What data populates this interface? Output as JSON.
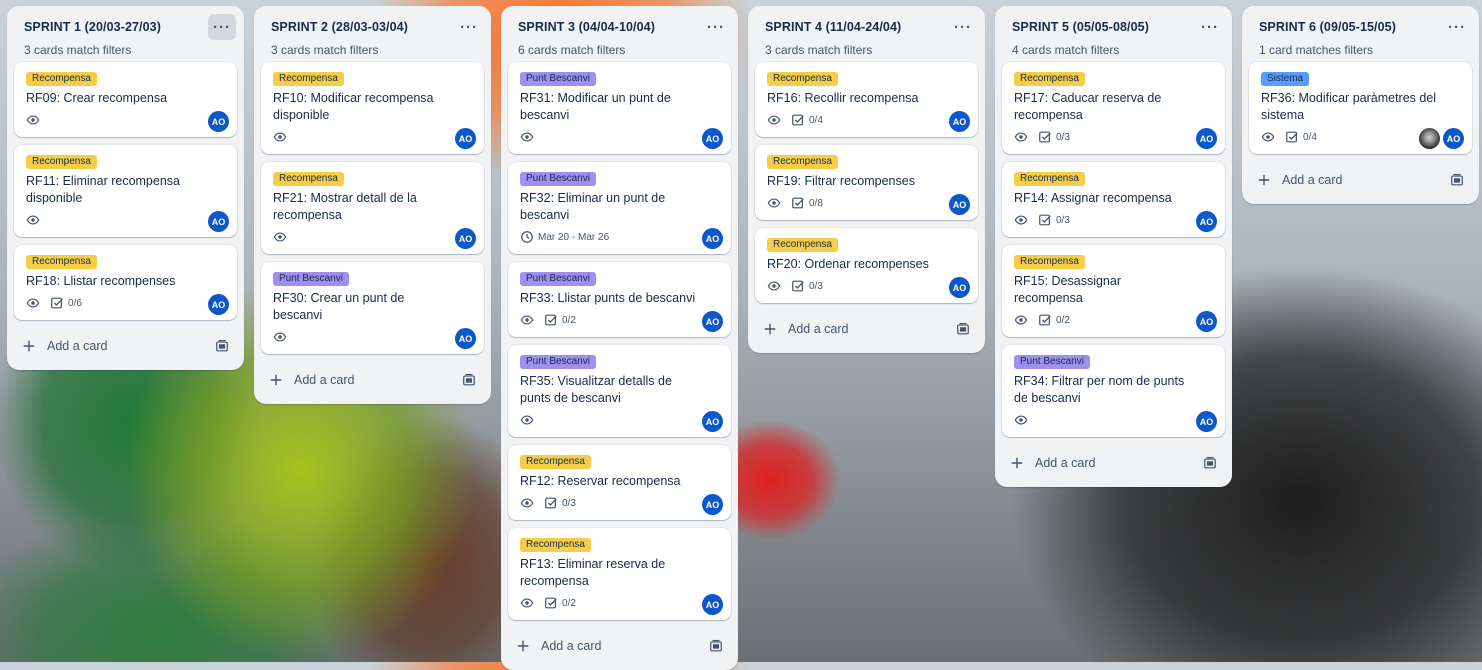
{
  "lists": [
    {
      "title": "SPRINT 1 (20/03-27/03)",
      "subtitle": "3 cards match filters",
      "menu_label": "···",
      "add_card_label": "Add a card",
      "cards": [
        {
          "label": "Recompensa",
          "label_color": "#f5cd47",
          "title": "RF09: Crear recompensa",
          "checklist": "",
          "dates": "",
          "members": [
            "AO"
          ]
        },
        {
          "label": "Recompensa",
          "label_color": "#f5cd47",
          "title": "RF11: Eliminar recompensa disponible",
          "checklist": "",
          "dates": "",
          "members": [
            "AO"
          ]
        },
        {
          "label": "Recompensa",
          "label_color": "#f5cd47",
          "title": "RF18: Llistar recompenses",
          "checklist": "0/6",
          "dates": "",
          "members": [
            "AO"
          ]
        }
      ]
    },
    {
      "title": "SPRINT 2 (28/03-03/04)",
      "subtitle": "3 cards match filters",
      "menu_label": "···",
      "add_card_label": "Add a card",
      "cards": [
        {
          "label": "Recompensa",
          "label_color": "#f5cd47",
          "title": "RF10: Modificar recompensa disponible",
          "checklist": "",
          "dates": "",
          "members": [
            "AO"
          ]
        },
        {
          "label": "Recompensa",
          "label_color": "#f5cd47",
          "title": "RF21: Mostrar detall de la recompensa",
          "checklist": "",
          "dates": "",
          "members": [
            "AO"
          ]
        },
        {
          "label": "Punt Bescanvi",
          "label_color": "#9f8fef",
          "title": "RF30: Crear un punt de bescanvi",
          "checklist": "",
          "dates": "",
          "members": [
            "AO"
          ]
        }
      ]
    },
    {
      "title": "SPRINT 3 (04/04-10/04)",
      "subtitle": "6 cards match filters",
      "menu_label": "···",
      "add_card_label": "Add a card",
      "cards": [
        {
          "label": "Punt Bescanvi",
          "label_color": "#9f8fef",
          "title": "RF31: Modificar un punt de bescanvi",
          "checklist": "",
          "dates": "",
          "members": [
            "AO"
          ]
        },
        {
          "label": "Punt Bescanvi",
          "label_color": "#9f8fef",
          "title": "RF32: Eliminar un punt de bescanvi",
          "checklist": "",
          "dates": "Mar 20 - Mar 26",
          "members": [
            "AO"
          ]
        },
        {
          "label": "Punt Bescanvi",
          "label_color": "#9f8fef",
          "title": "RF33: Llistar punts de bescanvi",
          "checklist": "0/2",
          "dates": "",
          "members": [
            "AO"
          ]
        },
        {
          "label": "Punt Bescanvi",
          "label_color": "#9f8fef",
          "title": "RF35: Visualitzar detalls de punts de bescanvi",
          "checklist": "",
          "dates": "",
          "members": [
            "AO"
          ]
        },
        {
          "label": "Recompensa",
          "label_color": "#f5cd47",
          "title": "RF12: Reservar recompensa",
          "checklist": "0/3",
          "dates": "",
          "members": [
            "AO"
          ]
        },
        {
          "label": "Recompensa",
          "label_color": "#f5cd47",
          "title": "RF13: Eliminar reserva de recompensa",
          "checklist": "0/2",
          "dates": "",
          "members": [
            "AO"
          ]
        }
      ]
    },
    {
      "title": "SPRINT 4 (11/04-24/04)",
      "subtitle": "3 cards match filters",
      "menu_label": "···",
      "add_card_label": "Add a card",
      "cards": [
        {
          "label": "Recompensa",
          "label_color": "#f5cd47",
          "title": "RF16: Recollir recompensa",
          "checklist": "0/4",
          "dates": "",
          "members": [
            "AO"
          ]
        },
        {
          "label": "Recompensa",
          "label_color": "#f5cd47",
          "title": "RF19: Filtrar recompenses",
          "checklist": "0/8",
          "dates": "",
          "members": [
            "AO"
          ]
        },
        {
          "label": "Recompensa",
          "label_color": "#f5cd47",
          "title": "RF20: Ordenar recompenses",
          "checklist": "0/3",
          "dates": "",
          "members": [
            "AO"
          ]
        }
      ]
    },
    {
      "title": "SPRINT 5 (05/05-08/05)",
      "subtitle": "4 cards match filters",
      "menu_label": "···",
      "add_card_label": "Add a card",
      "cards": [
        {
          "label": "Recompensa",
          "label_color": "#f5cd47",
          "title": "RF17: Caducar reserva de recompensa",
          "checklist": "0/3",
          "dates": "",
          "members": [
            "AO"
          ]
        },
        {
          "label": "Recompensa",
          "label_color": "#f5cd47",
          "title": "RF14: Assignar recompensa",
          "checklist": "0/3",
          "dates": "",
          "members": [
            "AO"
          ]
        },
        {
          "label": "Recompensa",
          "label_color": "#f5cd47",
          "title": "RF15: Desassignar recompensa",
          "checklist": "0/2",
          "dates": "",
          "members": [
            "AO"
          ]
        },
        {
          "label": "Punt Bescanvi",
          "label_color": "#9f8fef",
          "title": "RF34: Filtrar per nom de punts de bescanvi",
          "checklist": "",
          "dates": "",
          "members": [
            "AO"
          ]
        }
      ]
    },
    {
      "title": "SPRINT 6 (09/05-15/05)",
      "subtitle": "1 card matches filters",
      "menu_label": "···",
      "add_card_label": "Add a card",
      "cards": [
        {
          "label": "Sistema",
          "label_color": "#579dff",
          "title": "RF36: Modificar paràmetres del sistema",
          "checklist": "0/4",
          "dates": "",
          "members": [
            "photo",
            "AO"
          ]
        }
      ]
    }
  ]
}
